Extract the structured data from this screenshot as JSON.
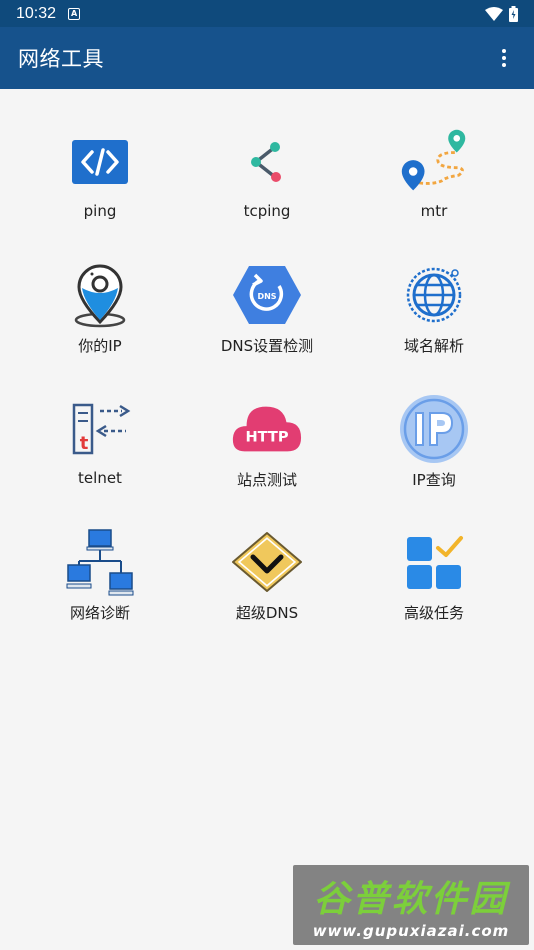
{
  "status_bar": {
    "time": "10:32",
    "notif_glyph": "A"
  },
  "app_bar": {
    "title": "网络工具",
    "menu_icon": "more-vert-icon"
  },
  "tools": [
    {
      "label": "ping",
      "icon": "code-icon"
    },
    {
      "label": "tcping",
      "icon": "share-nodes-icon"
    },
    {
      "label": "mtr",
      "icon": "route-map-icon"
    },
    {
      "label": "你的IP",
      "icon": "location-pin-icon"
    },
    {
      "label": "DNS设置检测",
      "icon": "dns-refresh-icon"
    },
    {
      "label": "域名解析",
      "icon": "globe-icon"
    },
    {
      "label": "telnet",
      "icon": "telnet-icon"
    },
    {
      "label": "站点测试",
      "icon": "http-cloud-icon"
    },
    {
      "label": "IP查询",
      "icon": "ip-badge-icon"
    },
    {
      "label": "网络诊断",
      "icon": "network-computers-icon"
    },
    {
      "label": "超级DNS",
      "icon": "chevron-badge-icon"
    },
    {
      "label": "高级任务",
      "icon": "tasks-grid-icon"
    }
  ],
  "watermark": {
    "main": "谷普软件园",
    "url": "www.gupuxiazai.com"
  }
}
